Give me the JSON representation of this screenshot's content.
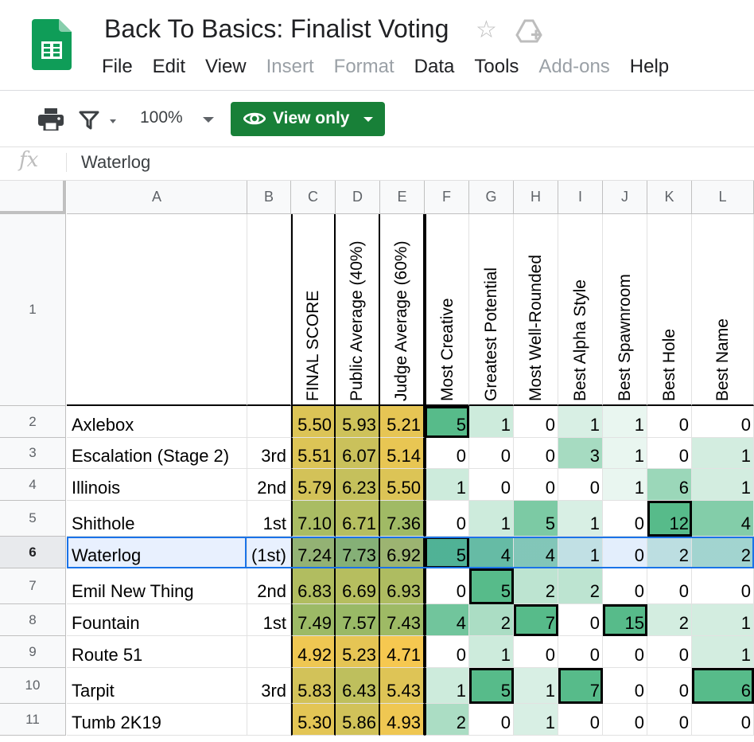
{
  "doc": {
    "title": "Back To Basics: Finalist Voting",
    "menu": [
      {
        "label": "File",
        "enabled": true
      },
      {
        "label": "Edit",
        "enabled": true
      },
      {
        "label": "View",
        "enabled": true
      },
      {
        "label": "Insert",
        "enabled": false
      },
      {
        "label": "Format",
        "enabled": false
      },
      {
        "label": "Data",
        "enabled": true
      },
      {
        "label": "Tools",
        "enabled": true
      },
      {
        "label": "Add-ons",
        "enabled": false
      },
      {
        "label": "Help",
        "enabled": true
      }
    ]
  },
  "toolbar": {
    "zoom": "100%",
    "view_only_label": "View only",
    "icons": [
      "print-icon",
      "filter-icon",
      "eye-icon"
    ]
  },
  "formula_bar": {
    "fx": "fx",
    "value": "Waterlog"
  },
  "colors": {
    "sheets_green": "#0f9d58",
    "view_only_bg": "#188038",
    "selection_blue": "#1a73e8"
  },
  "sheet": {
    "columns": [
      "A",
      "B",
      "C",
      "D",
      "E",
      "F",
      "G",
      "H",
      "I",
      "J",
      "K",
      "L"
    ],
    "row_numbers": [
      "1",
      "2",
      "3",
      "4",
      "5",
      "6",
      "7",
      "8",
      "9",
      "10",
      "11"
    ],
    "headers": [
      "",
      "",
      "FINAL SCORE",
      "Public Average (40%)",
      "Judge Average (60%)",
      "Most Creative",
      "Greatest Potential",
      "Most Well-Rounded",
      "Best Alpha Style",
      "Best Spawnroom",
      "Best Hole",
      "Best Name"
    ],
    "rows": [
      {
        "name": "Axlebox",
        "place": "",
        "final": "5.50",
        "public": "5.93",
        "judge": "5.21",
        "votes": [
          "5",
          "1",
          "0",
          "1",
          "1",
          "0",
          "0"
        ]
      },
      {
        "name": "Escalation (Stage 2)",
        "place": "3rd",
        "final": "5.51",
        "public": "6.07",
        "judge": "5.14",
        "votes": [
          "0",
          "0",
          "0",
          "3",
          "1",
          "0",
          "1"
        ]
      },
      {
        "name": "Illinois",
        "place": "2nd",
        "final": "5.79",
        "public": "6.23",
        "judge": "5.50",
        "votes": [
          "1",
          "0",
          "0",
          "0",
          "1",
          "6",
          "1"
        ]
      },
      {
        "name": "Shithole",
        "place": "1st",
        "final": "7.10",
        "public": "6.71",
        "judge": "7.36",
        "votes": [
          "0",
          "1",
          "5",
          "1",
          "0",
          "12",
          "4"
        ]
      },
      {
        "name": "Waterlog",
        "place": "(1st)",
        "final": "7.24",
        "public": "7.73",
        "judge": "6.92",
        "votes": [
          "5",
          "4",
          "4",
          "1",
          "0",
          "2",
          "2"
        ]
      },
      {
        "name": "Emil New Thing",
        "place": "2nd",
        "final": "6.83",
        "public": "6.69",
        "judge": "6.93",
        "votes": [
          "0",
          "5",
          "2",
          "2",
          "0",
          "0",
          "0"
        ]
      },
      {
        "name": "Fountain",
        "place": "1st",
        "final": "7.49",
        "public": "7.57",
        "judge": "7.43",
        "votes": [
          "4",
          "2",
          "7",
          "0",
          "15",
          "2",
          "1"
        ]
      },
      {
        "name": "Route 51",
        "place": "",
        "final": "4.92",
        "public": "5.23",
        "judge": "4.71",
        "votes": [
          "0",
          "1",
          "0",
          "0",
          "0",
          "0",
          "1"
        ]
      },
      {
        "name": "Tarpit",
        "place": "3rd",
        "final": "5.83",
        "public": "6.43",
        "judge": "5.43",
        "votes": [
          "1",
          "5",
          "1",
          "7",
          "0",
          "0",
          "6"
        ]
      },
      {
        "name": "Tumb 2K19",
        "place": "",
        "final": "5.30",
        "public": "5.86",
        "judge": "4.93",
        "votes": [
          "2",
          "0",
          "1",
          "0",
          "0",
          "0",
          "0"
        ]
      }
    ],
    "selected_row": "6",
    "selected_cell": "A6"
  }
}
